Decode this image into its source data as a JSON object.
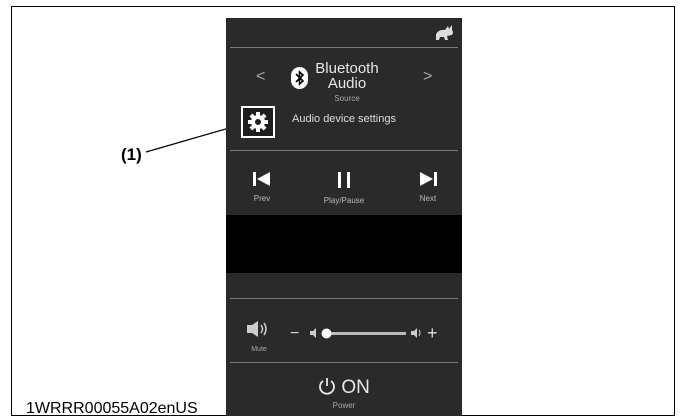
{
  "doc_id": "1WRRR00055A02enUS",
  "callout": {
    "label": "(1)"
  },
  "phone": {
    "source": {
      "title": "Bluetooth Audio",
      "subtitle": "Source",
      "prev_icon": "chevron-left-icon",
      "next_icon": "chevron-right-icon",
      "glyph_prev": "<",
      "glyph_next": ">"
    },
    "settings": {
      "label": "Audio device settings",
      "icon": "gear-icon"
    },
    "controls": {
      "prev": {
        "label": "Prev",
        "icon": "skip-previous-icon"
      },
      "play": {
        "label": "Play/Pause",
        "icon": "pause-icon"
      },
      "next": {
        "label": "Next",
        "icon": "skip-next-icon"
      }
    },
    "volume": {
      "mute_label": "Mute",
      "minus": "−",
      "plus": "+",
      "level": 0.03
    },
    "power": {
      "text": "ON",
      "label": "Power"
    }
  },
  "colors": {
    "panel": "#2a2a2a",
    "screen": "#000000",
    "text": "#dddddd"
  }
}
